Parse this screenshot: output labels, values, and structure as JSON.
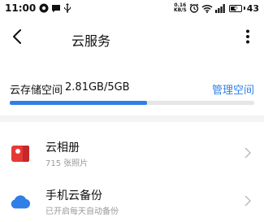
{
  "status_bar": {
    "time": "11:00",
    "speed_value": "0.16",
    "speed_unit": "KB/S",
    "battery_level": "43",
    "icons": [
      "notification-icon",
      "message-icon",
      "usb-icon",
      "alarm-icon",
      "wifi-icon",
      "signal-icon",
      "battery-icon"
    ]
  },
  "header": {
    "title": "云服务",
    "back_icon": "back-arrow-icon",
    "more_icon": "more-vertical-icon"
  },
  "storage": {
    "label": "云存储空间",
    "usage": "2.81GB/5GB",
    "usage_fraction": 0.562,
    "manage_label": "管理空间",
    "accent_color": "#2f7fe6"
  },
  "list": {
    "items": [
      {
        "title": "云相册",
        "subtitle": "715 张照片",
        "icon": "photo-album-icon",
        "icon_color": "#e53935"
      },
      {
        "title": "手机云备份",
        "subtitle": "已开启每天自动备份",
        "icon": "cloud-icon",
        "icon_color": "#2f7fe6"
      }
    ]
  }
}
